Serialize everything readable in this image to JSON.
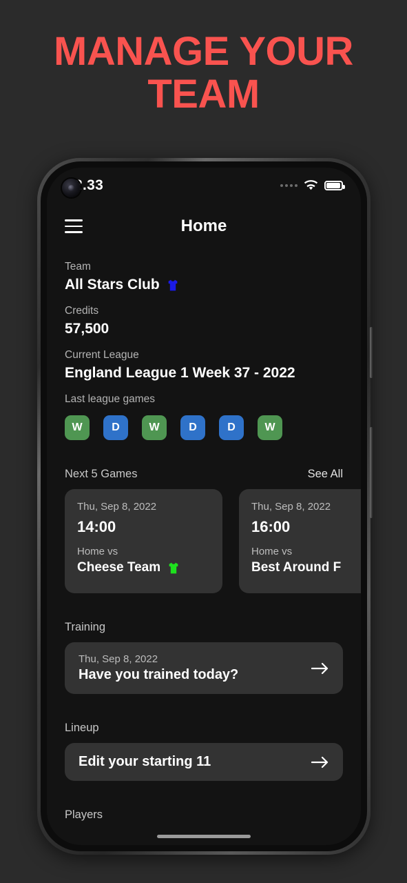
{
  "headline": "MANAGE YOUR\nTEAM",
  "headline_color": "#f9534f",
  "status_bar": {
    "time": "2.33",
    "wifi_icon": "wifi-icon",
    "battery_icon": "battery-full-icon",
    "signal_icon": "signal-dots-icon"
  },
  "app_bar": {
    "menu_icon": "hamburger-menu-icon",
    "title": "Home"
  },
  "team": {
    "label": "Team",
    "name": "All Stars Club",
    "jersey_icon": "jersey-icon",
    "jersey_color": "#1a1ae6"
  },
  "credits": {
    "label": "Credits",
    "value": "57,500"
  },
  "league": {
    "label": "Current League",
    "value": "England League 1 Week 37 - 2022"
  },
  "last_games": {
    "label": "Last league games",
    "results": [
      {
        "letter": "W",
        "kind": "w"
      },
      {
        "letter": "D",
        "kind": "d"
      },
      {
        "letter": "W",
        "kind": "w"
      },
      {
        "letter": "D",
        "kind": "d"
      },
      {
        "letter": "D",
        "kind": "d"
      },
      {
        "letter": "W",
        "kind": "w"
      }
    ],
    "win_color": "#4f9652",
    "draw_color": "#2f72c9"
  },
  "next_games": {
    "title": "Next 5 Games",
    "see_all": "See All",
    "cards": [
      {
        "date": "Thu, Sep 8, 2022",
        "time": "14:00",
        "venue": "Home vs",
        "opponent": "Cheese Team",
        "jersey_icon": "jersey-icon",
        "jersey_color": "#1ee11e"
      },
      {
        "date": "Thu, Sep 8, 2022",
        "time": "16:00",
        "venue": "Home vs",
        "opponent": "Best Around F",
        "jersey_icon": "jersey-icon",
        "jersey_color": "#1ee11e"
      }
    ]
  },
  "training": {
    "title": "Training",
    "date": "Thu, Sep 8, 2022",
    "prompt": "Have you trained today?",
    "arrow_icon": "arrow-right-icon"
  },
  "lineup": {
    "title": "Lineup",
    "action": "Edit your starting 11",
    "arrow_icon": "arrow-right-icon"
  },
  "players": {
    "title": "Players"
  }
}
